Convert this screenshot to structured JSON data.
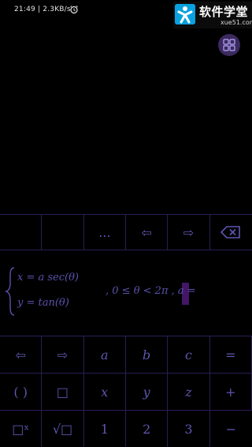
{
  "status_bar": {
    "text": "21:49 | 2.3KB/s",
    "alarm_icon": "alarm-clock-icon"
  },
  "watermark": {
    "main": "软件学堂",
    "sub": "xue51.com"
  },
  "menu_button": {
    "icon": "grid-menu-icon"
  },
  "top_row": [
    {
      "label": "",
      "name": "blank-key-1"
    },
    {
      "label": "",
      "name": "blank-key-2"
    },
    {
      "label": "...",
      "name": "more-key"
    },
    {
      "label": "⇦",
      "name": "arrow-left-key"
    },
    {
      "label": "⇨",
      "name": "arrow-right-key"
    },
    {
      "label": "⌫",
      "name": "backspace-key"
    }
  ],
  "expression": {
    "line1": "x = a sec(θ)",
    "line2": "y = tan(θ)",
    "condition": ",   0 ≤ θ < 2π ,  a ="
  },
  "keys": [
    [
      "⇦",
      "⇨",
      "a",
      "b",
      "c",
      "="
    ],
    [
      "( )",
      "□",
      "x",
      "y",
      "z",
      "+"
    ],
    [
      "□ˣ",
      "√□",
      "1",
      "2",
      "3",
      "−"
    ]
  ],
  "colors": {
    "background": "#000000",
    "grid_line": "#2a1d55",
    "key_text": "#5e56b0",
    "cursor": "#5a1e8a"
  }
}
